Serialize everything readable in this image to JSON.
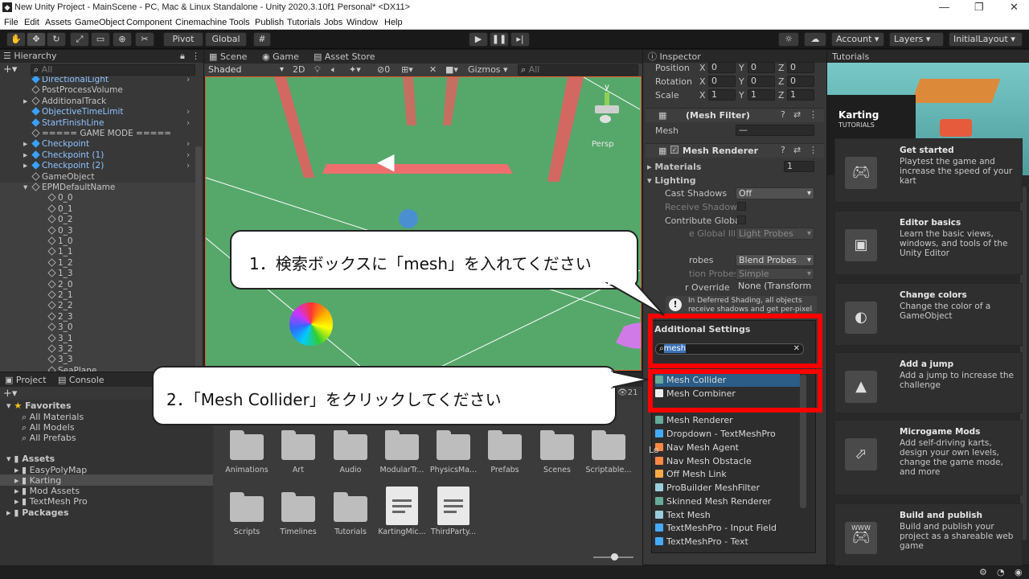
{
  "window": {
    "title": "New Unity Project - MainScene - PC, Mac & Linux Standalone - Unity 2020.3.10f1 Personal* <DX11>"
  },
  "menu": [
    "File",
    "Edit",
    "Assets",
    "GameObject",
    "Component",
    "Cinemachine",
    "Tools",
    "Publish",
    "Tutorials",
    "Jobs",
    "Window",
    "Help"
  ],
  "toolbar": {
    "pivot": "Pivot",
    "global": "Global",
    "account": "Account",
    "layers": "Layers",
    "layout": "InitialLayout"
  },
  "hierarchy": {
    "tab": "Hierarchy",
    "search_placeholder": "All",
    "items": [
      {
        "label": "DirectionalLight",
        "blue": true
      },
      {
        "label": "PostProcessVolume",
        "blue": false
      },
      {
        "label": "AdditionalTrack",
        "blue": false
      },
      {
        "label": "ObjectiveTimeLimit",
        "blue": true
      },
      {
        "label": "StartFinishLine",
        "blue": true
      },
      {
        "label": "===== GAME MODE =====",
        "blue": false
      },
      {
        "label": "Checkpoint",
        "blue": true
      },
      {
        "label": "Checkpoint (1)",
        "blue": true
      },
      {
        "label": "Checkpoint (2)",
        "blue": true
      },
      {
        "label": "GameObject",
        "blue": false
      },
      {
        "label": "EPMDefaultName",
        "blue": false
      },
      {
        "label": "0_0",
        "blue": false
      },
      {
        "label": "0_1",
        "blue": false
      },
      {
        "label": "0_2",
        "blue": false
      },
      {
        "label": "0_3",
        "blue": false
      },
      {
        "label": "1_0",
        "blue": false
      },
      {
        "label": "1_1",
        "blue": false
      },
      {
        "label": "1_2",
        "blue": false
      },
      {
        "label": "1_3",
        "blue": false
      },
      {
        "label": "2_0",
        "blue": false
      },
      {
        "label": "2_1",
        "blue": false
      },
      {
        "label": "2_2",
        "blue": false
      },
      {
        "label": "2_3",
        "blue": false
      },
      {
        "label": "3_0",
        "blue": false
      },
      {
        "label": "3_1",
        "blue": false
      },
      {
        "label": "3_2",
        "blue": false
      },
      {
        "label": "3_3",
        "blue": false
      },
      {
        "label": "SeaPlane",
        "blue": false
      }
    ]
  },
  "scene": {
    "tabs": [
      "Scene",
      "Game",
      "Asset Store"
    ],
    "shading": "Shaded",
    "mode2d": "2D",
    "gizmos": "Gizmos",
    "search_placeholder": "All",
    "persp": "Persp",
    "axis_y": "y",
    "fx_count": "0"
  },
  "inspector": {
    "tab": "Inspector",
    "position": {
      "label": "Position",
      "x": "0",
      "y": "0",
      "z": "0"
    },
    "rotation": {
      "label": "Rotation",
      "x": "0",
      "y": "0",
      "z": "0"
    },
    "scale": {
      "label": "Scale",
      "x": "1",
      "y": "1",
      "z": "1"
    },
    "axis": {
      "x": "X",
      "y": "Y",
      "z": "Z"
    },
    "mesh_filter": "(Mesh Filter)",
    "mesh_label": "Mesh",
    "mesh_value": "—",
    "mesh_renderer": "Mesh Renderer",
    "materials": "Materials",
    "materials_count": "1",
    "lighting": "Lighting",
    "cast_shadows": "Cast Shadows",
    "cast_shadows_value": "Off",
    "receive_shadows": "Receive Shadows",
    "contribute_global": "Contribute Global",
    "receive_gi_partial": "e Global Illu",
    "receive_gi_value": "Light Probes",
    "probes_partial": "robes",
    "probes_value": "Blend Probes",
    "refl_partial": "tion Probes",
    "refl_value": "Simple",
    "override_partial": "r Override",
    "override_value": "None (Transform",
    "info_text": "In Deferred Shading, all objects receive shadows and get per-pixel",
    "additional_settings": "Additional Settings",
    "search_value": "mesh",
    "results": [
      {
        "label": "Mesh Collider",
        "selected": true
      },
      {
        "label": "Mesh Combiner",
        "selected": false
      },
      {
        "label": "Mesh Renderer",
        "selected": false
      },
      {
        "label": "Dropdown - TextMeshPro",
        "selected": false
      },
      {
        "label": "Nav Mesh Agent",
        "selected": false
      },
      {
        "label": "Nav Mesh Obstacle",
        "selected": false
      },
      {
        "label": "Off Mesh Link",
        "selected": false
      },
      {
        "label": "ProBuilder MeshFilter",
        "selected": false
      },
      {
        "label": "Skinned Mesh Renderer",
        "selected": false
      },
      {
        "label": "Text Mesh",
        "selected": false
      },
      {
        "label": "TextMeshPro - Input Field",
        "selected": false
      },
      {
        "label": "TextMeshPro - Text",
        "selected": false
      }
    ],
    "lo_partial": "Lo"
  },
  "project": {
    "tabs": [
      "Project",
      "Console"
    ],
    "favorites": "Favorites",
    "fav_items": [
      "All Materials",
      "All Models",
      "All Prefabs"
    ],
    "assets": "Assets",
    "asset_items": [
      "EasyPolyMap",
      "Karting",
      "Mod Assets",
      "TextMesh Pro"
    ],
    "packages": "Packages",
    "count": "21",
    "folders": [
      "Animations",
      "Art",
      "Audio",
      "ModularTr...",
      "PhysicsMa...",
      "Prefabs",
      "Scenes",
      "Scriptable...",
      "Scripts",
      "Timelines",
      "Tutorials"
    ],
    "files": [
      "KartingMic...",
      "ThirdParty..."
    ]
  },
  "tutorials": {
    "tab": "Tutorials",
    "header_title": "Karting",
    "header_sub": "TUTORIALS",
    "cards": [
      {
        "title": "Get started",
        "desc": "Playtest the game and increase the speed of your kart"
      },
      {
        "title": "Editor basics",
        "desc": "Learn the basic views, windows, and tools of the Unity Editor"
      },
      {
        "title": "Change colors",
        "desc": "Change the color of a GameObject"
      },
      {
        "title": "Add a jump",
        "desc": "Add a jump to increase the challenge"
      },
      {
        "title": "Microgame Mods",
        "desc": "Add self-driving karts, design your own levels, change the game mode, and more"
      },
      {
        "title": "Build and publish",
        "desc": "Build and publish your project as a shareable web game"
      }
    ],
    "www": "WWW"
  },
  "callouts": {
    "one": "1．検索ボックスに「mesh」を入れてください",
    "two": "2．「Mesh Collider」をクリックしてください"
  },
  "colors": {
    "highlight": "#ff0000",
    "selected_row": "#2c5d87",
    "scene_ground": "#56a86a"
  }
}
